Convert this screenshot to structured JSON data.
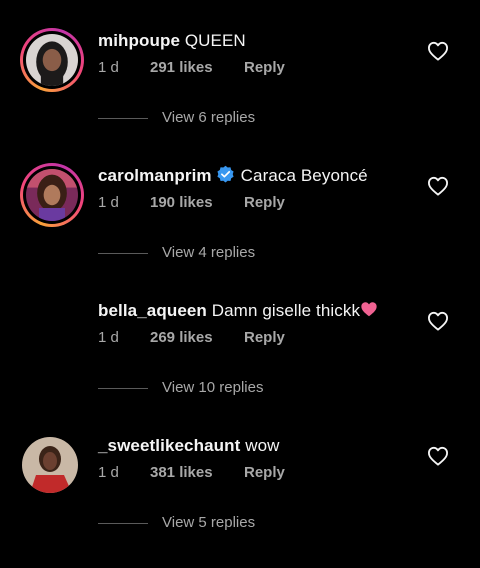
{
  "comments": [
    {
      "username": "mihpoupe",
      "text": "QUEEN",
      "verified": false,
      "time": "1 d",
      "likes": "291 likes",
      "reply": "Reply",
      "replies": "View 6 replies",
      "avatar_ring": true
    },
    {
      "username": "carolmanprim",
      "text": "Caraca Beyoncé",
      "verified": true,
      "time": "1 d",
      "likes": "190 likes",
      "reply": "Reply",
      "replies": "View 4 replies",
      "avatar_ring": true
    },
    {
      "username": "bella_aqueen",
      "text": "Damn giselle thickk",
      "emoji": "pink-heart-icon",
      "verified": false,
      "time": "1 d",
      "likes": "269 likes",
      "reply": "Reply",
      "replies": "View 10 replies",
      "avatar_ring": false
    },
    {
      "username": "_sweetlikechaunt",
      "text": "wow",
      "verified": false,
      "time": "1 d",
      "likes": "381 likes",
      "reply": "Reply",
      "replies": "View 5 replies",
      "avatar_ring": false
    }
  ],
  "colors": {
    "background": "#000000",
    "primary_text": "#f5f5f5",
    "secondary_text": "#a8a8a8",
    "verified_badge": "#3897f0",
    "heart_emoji": "#f06292",
    "story_ring_start": "#f9a13a",
    "story_ring_end": "#c234a8"
  }
}
